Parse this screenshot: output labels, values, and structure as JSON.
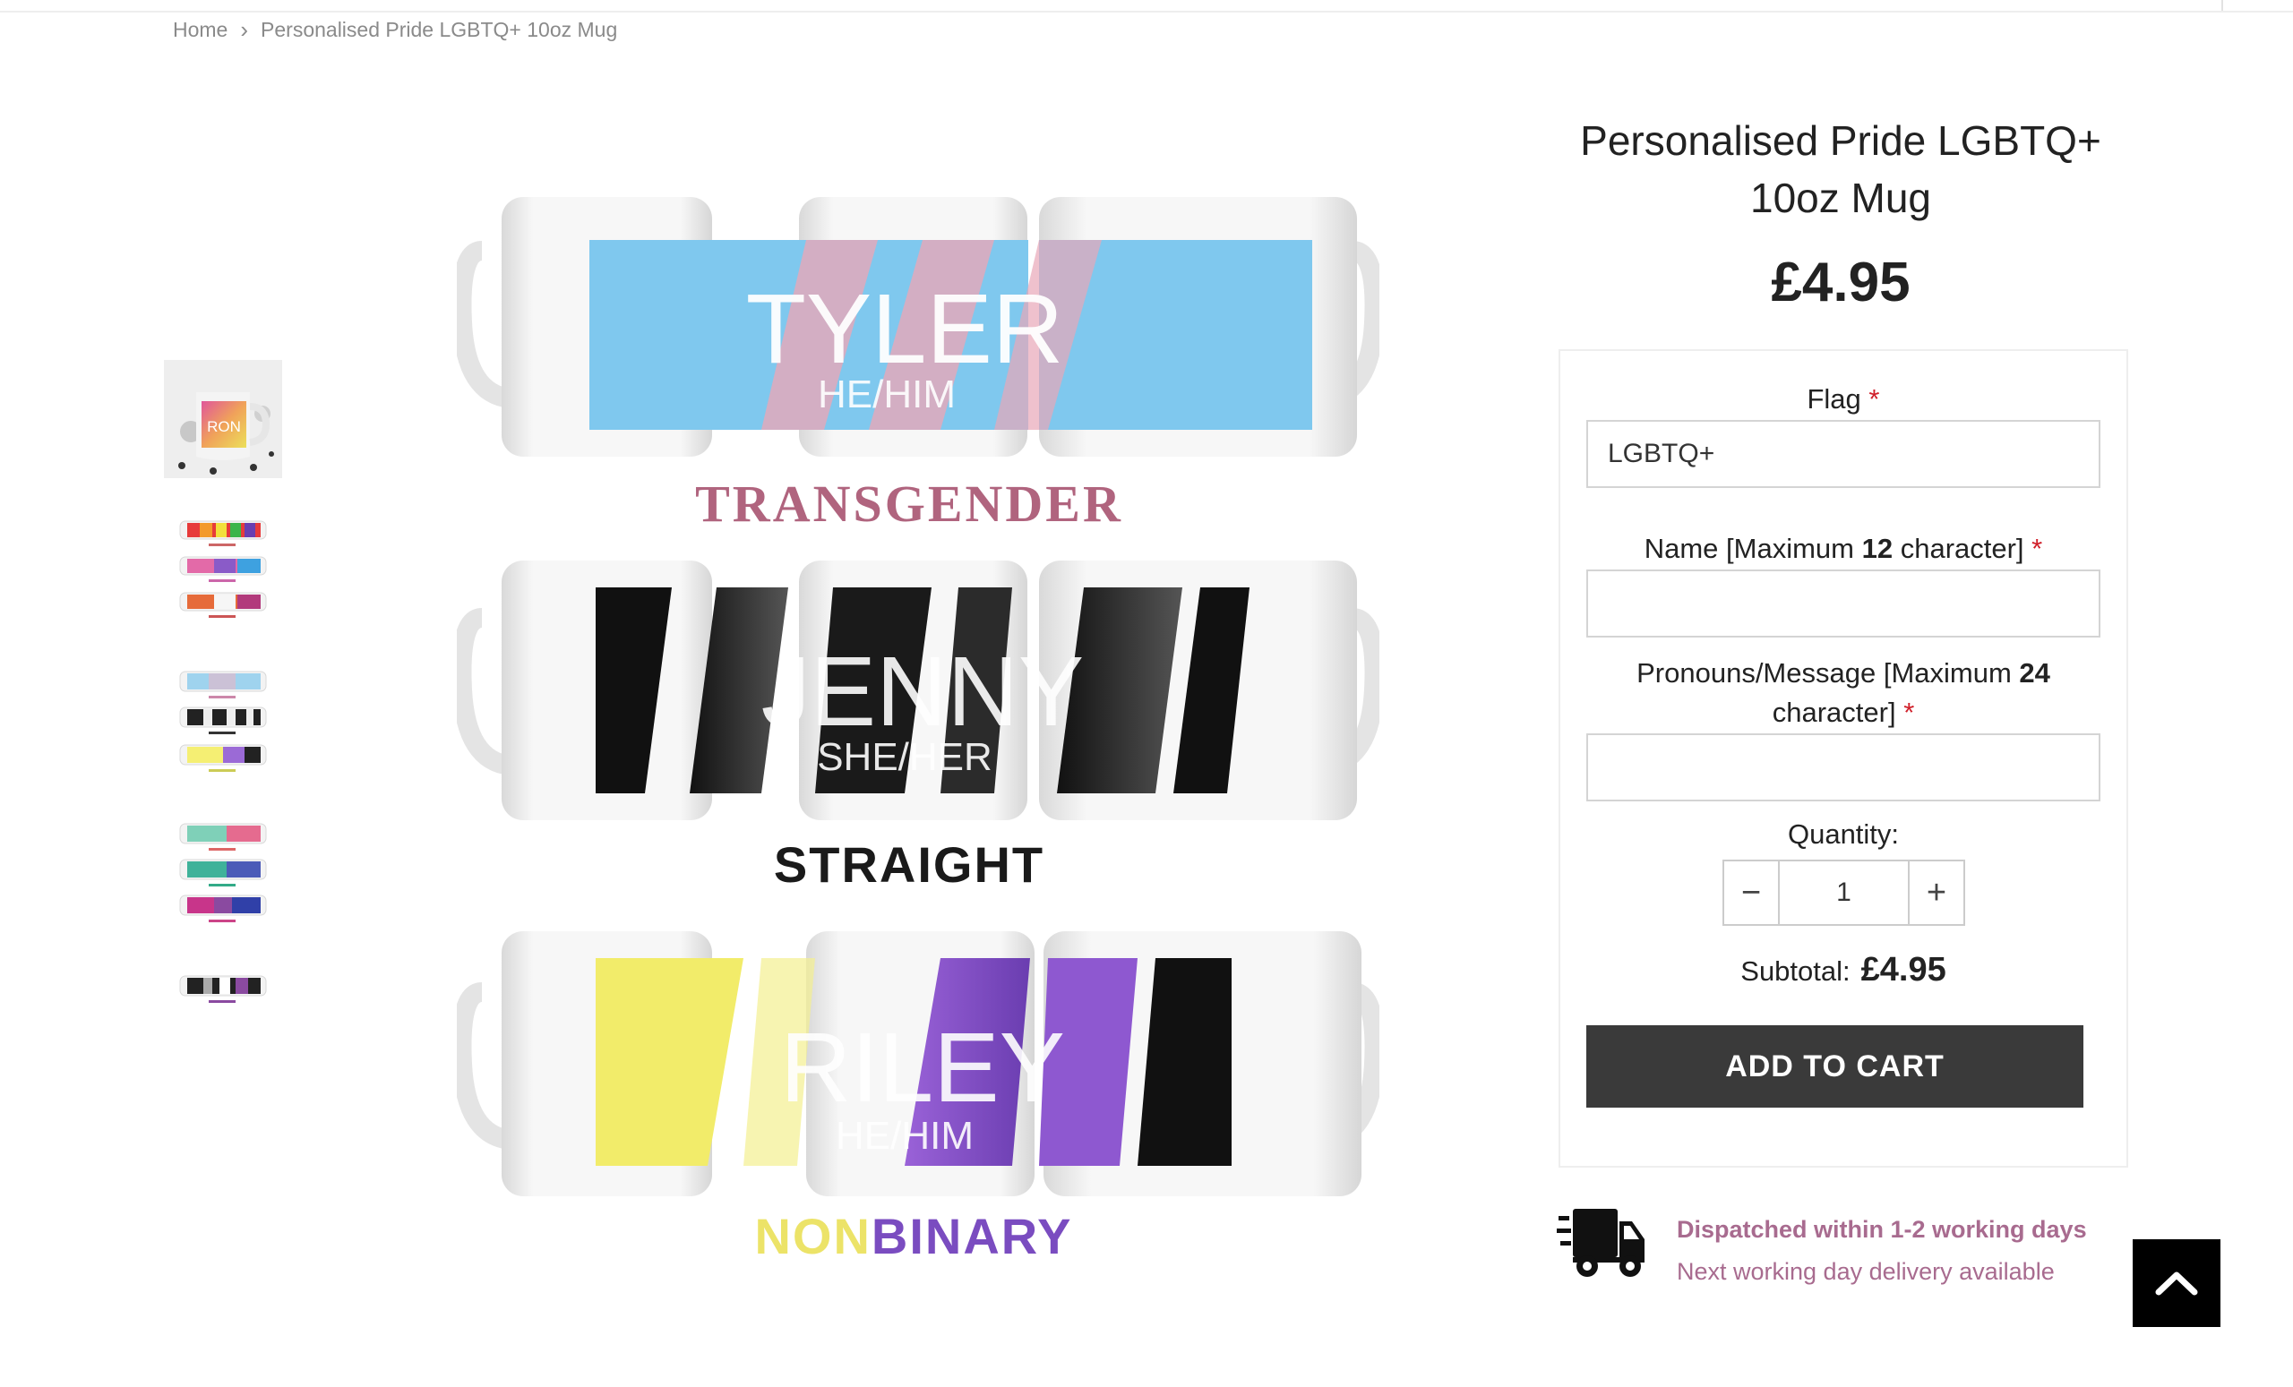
{
  "breadcrumb": {
    "home": "Home",
    "current": "Personalised Pride LGBTQ+ 10oz Mug"
  },
  "product": {
    "title": "Personalised Pride LGBTQ+ 10oz Mug",
    "price": "£4.95"
  },
  "form": {
    "flag_label": "Flag",
    "flag_value": "LGBTQ+",
    "name_label_pre": "Name [Maximum ",
    "name_label_num": "12",
    "name_label_post": " character]",
    "pronouns_label_pre": "Pronouns/Message [Maximum ",
    "pronouns_label_num": "24",
    "pronouns_label_post": " character]",
    "required_mark": "*",
    "quantity_label": "Quantity:",
    "quantity_value": "1",
    "minus": "−",
    "plus": "+",
    "subtotal_label": "Subtotal:",
    "subtotal_value": "£4.95",
    "add_to_cart": "ADD TO CART"
  },
  "gallery": {
    "thumb1_text": "RON",
    "mugs": [
      {
        "name": "TYLER",
        "sub": "HE/HIM",
        "caption": "TRANSGENDER"
      },
      {
        "name": "JENNY",
        "sub": "SHE/HER",
        "caption": "STRAIGHT"
      },
      {
        "name": "RILEY",
        "sub": "HE/HIM",
        "caption_a": "NON",
        "caption_b": "BINARY"
      }
    ]
  },
  "dispatch": {
    "title": "Dispatched within 1-2 working days",
    "subtitle": "Next working day delivery available"
  },
  "colors": {
    "accent": "#a86b8f",
    "required": "#d0202a",
    "button": "#3a3a3a"
  },
  "icons": {
    "breadcrumb_sep": "chevron-right-icon",
    "dispatch": "truck-icon",
    "back_to_top": "chevron-up-icon"
  }
}
